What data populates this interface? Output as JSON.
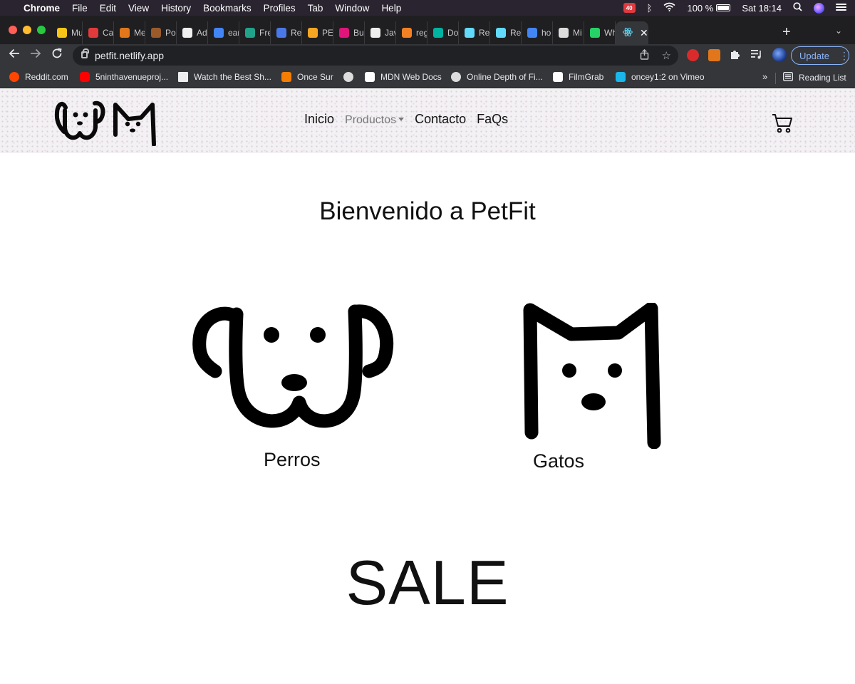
{
  "menubar": {
    "app_name": "Chrome",
    "menus": [
      "File",
      "Edit",
      "View",
      "History",
      "Bookmarks",
      "Profiles",
      "Tab",
      "Window",
      "Help"
    ],
    "battery": "100 %",
    "clock": "Sat 18:14",
    "notification_badge": "40"
  },
  "tabs": [
    {
      "title": "Mu",
      "color": "#f5c518"
    },
    {
      "title": "Ca",
      "color": "#e03a3a"
    },
    {
      "title": "Me",
      "color": "#e2761b"
    },
    {
      "title": "Po",
      "color": "#9a5a2a"
    },
    {
      "title": "Ad",
      "color": "#f0f0f0"
    },
    {
      "title": "ear",
      "color": "#4285f4"
    },
    {
      "title": "Fre",
      "color": "#21a38b"
    },
    {
      "title": "Re",
      "color": "#4a78e8"
    },
    {
      "title": "PE",
      "color": "#f5a623"
    },
    {
      "title": "Bu",
      "color": "#e0157a"
    },
    {
      "title": "Jav",
      "color": "#eeeeee"
    },
    {
      "title": "reg",
      "color": "#f48024"
    },
    {
      "title": "Do",
      "color": "#00b3a1"
    },
    {
      "title": "Re",
      "color": "#61dafb"
    },
    {
      "title": "Re",
      "color": "#61dafb"
    },
    {
      "title": "ho",
      "color": "#4285f4"
    },
    {
      "title": "Mi",
      "color": "#dddddd"
    },
    {
      "title": "Wh",
      "color": "#25d366"
    }
  ],
  "active_tab": {
    "favicon_color": "#61dafb"
  },
  "toolbar": {
    "url": "petfit.netlify.app",
    "update_label": "Update"
  },
  "bookmarks": [
    {
      "label": "Reddit.com",
      "color": "#ff4500"
    },
    {
      "label": "5ninthavenueproj...",
      "color": "#ff0000"
    },
    {
      "label": "Watch the Best Sh...",
      "color": "#eeeeee"
    },
    {
      "label": "Once Sur",
      "color": "#f57d00"
    },
    {
      "label": "",
      "color": "#dddddd"
    },
    {
      "label": "MDN Web Docs",
      "color": "#ffffff"
    },
    {
      "label": "Online Depth of Fi...",
      "color": "#dddddd"
    },
    {
      "label": "FilmGrab",
      "color": "#ffffff"
    },
    {
      "label": "oncey1:2 on Vimeo",
      "color": "#1ab7ea"
    }
  ],
  "reading_list": "Reading List",
  "site": {
    "nav": {
      "inicio": "Inicio",
      "productos": "Productos",
      "contacto": "Contacto",
      "faqs": "FaQs"
    },
    "welcome": "Bienvenido a PetFit",
    "categories": {
      "dogs": "Perros",
      "cats": "Gatos"
    },
    "sale": "SALE"
  }
}
